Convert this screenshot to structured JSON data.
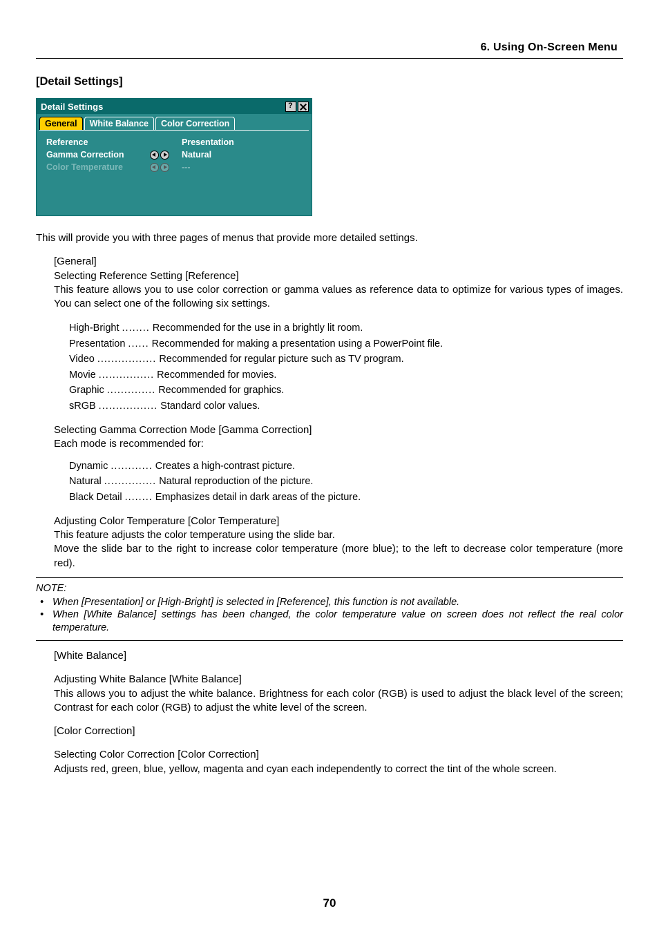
{
  "chapter": "6. Using On-Screen Menu",
  "section_title": "[Detail Settings]",
  "dialog": {
    "title": "Detail Settings",
    "tabs": [
      "General",
      "White Balance",
      "Color Correction"
    ],
    "rows": {
      "reference_label": "Reference",
      "reference_value": "Presentation",
      "gamma_label": "Gamma Correction",
      "gamma_value": "Natural",
      "colortemp_label": "Color Temperature",
      "colortemp_value": "---"
    }
  },
  "intro": "This will provide you with three pages of menus that provide more detailed settings.",
  "general": {
    "heading": "[General]",
    "ref_title": "Selecting Reference Setting [Reference]",
    "ref_desc": "This feature allows you to use color correction or gamma values as reference data to optimize for various types of images. You can select one of the following six settings.",
    "ref_items": [
      {
        "term": "High-Bright",
        "dots": "........",
        "desc": "Recommended for the use in a brightly lit room."
      },
      {
        "term": "Presentation",
        "dots": "......",
        "desc": "Recommended for making a presentation using a PowerPoint file."
      },
      {
        "term": "Video",
        "dots": ".................",
        "desc": "Recommended for regular picture such as TV program."
      },
      {
        "term": "Movie",
        "dots": "................",
        "desc": "Recommended for movies."
      },
      {
        "term": "Graphic",
        "dots": "..............",
        "desc": "Recommended for graphics."
      },
      {
        "term": "sRGB",
        "dots": ".................",
        "desc": "Standard color values."
      }
    ],
    "gamma_title": "Selecting Gamma Correction Mode [Gamma Correction]",
    "gamma_sub": "Each mode is recommended for:",
    "gamma_items": [
      {
        "term": "Dynamic",
        "dots": "............",
        "desc": "Creates a high-contrast picture."
      },
      {
        "term": "Natural",
        "dots": "...............",
        "desc": "Natural reproduction of the picture."
      },
      {
        "term": "Black Detail",
        "dots": "........",
        "desc": "Emphasizes detail in dark areas of the picture."
      }
    ],
    "ct_title": "Adjusting Color Temperature [Color Temperature]",
    "ct_line1": "This feature adjusts the color temperature using the slide bar.",
    "ct_line2": "Move the slide bar to the right to increase color temperature (more blue); to the left to decrease color temperature (more red)."
  },
  "note": {
    "label": "NOTE:",
    "bullets": [
      "When [Presentation] or [High-Bright] is selected in [Reference], this function is not available.",
      "When [White Balance] settings has been changed, the color temperature value on screen does not reflect the real color temperature."
    ]
  },
  "white_balance": {
    "heading": "[White Balance]",
    "title": "Adjusting White Balance [White Balance]",
    "desc": "This allows you to adjust the white balance. Brightness for each color (RGB) is used to adjust the black level of the screen; Contrast for each color (RGB) to adjust the white level of the screen."
  },
  "color_correction": {
    "heading": "[Color Correction]",
    "title": "Selecting Color Correction [Color Correction]",
    "desc": "Adjusts red, green, blue, yellow, magenta and cyan each independently to correct the tint of the whole screen."
  },
  "page_number": "70"
}
